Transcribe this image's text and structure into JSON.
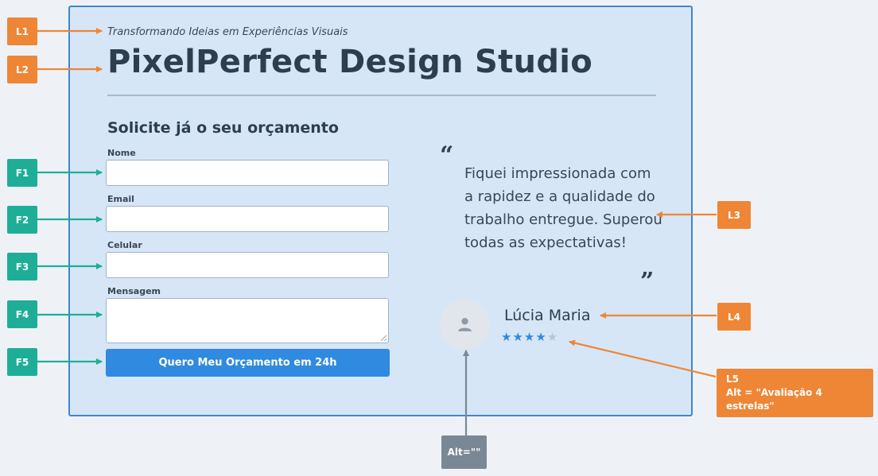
{
  "header": {
    "tagline": "Transformando Ideias em Experiências Visuais",
    "title": "PixelPerfect Design Studio"
  },
  "form": {
    "title": "Solicite já o seu orçamento",
    "fields": [
      {
        "label": "Nome",
        "value": ""
      },
      {
        "label": "Email",
        "value": ""
      },
      {
        "label": "Celular",
        "value": ""
      },
      {
        "label": "Mensagem",
        "value": ""
      }
    ],
    "submit_label": "Quero Meu Orçamento em 24h"
  },
  "testimonial": {
    "quote": "Fiquei impressionada com a rapidez e a qualidade do trabalho entregue. Superou todas as expectativas!",
    "author": "Lúcia Maria",
    "rating": 4,
    "rating_max": 5
  },
  "annotations": {
    "L1": "L1",
    "L2": "L2",
    "L3": "L3",
    "L4": "L4",
    "L5": "L5",
    "L5_alt": "Alt = \"Avaliação 4 estrelas\"",
    "F1": "F1",
    "F2": "F2",
    "F3": "F3",
    "F4": "F4",
    "F5": "F5",
    "avatar_alt": "Alt=\"\""
  },
  "colors": {
    "panel_bg": "#d6e6f6",
    "panel_border": "#3f86cf",
    "accent": "#2f8ae0",
    "tag_orange": "#ee8636",
    "tag_teal": "#1eae98",
    "tag_gray": "#7a8895"
  },
  "icons": {
    "avatar": "user-icon",
    "rating": "star-icon"
  }
}
